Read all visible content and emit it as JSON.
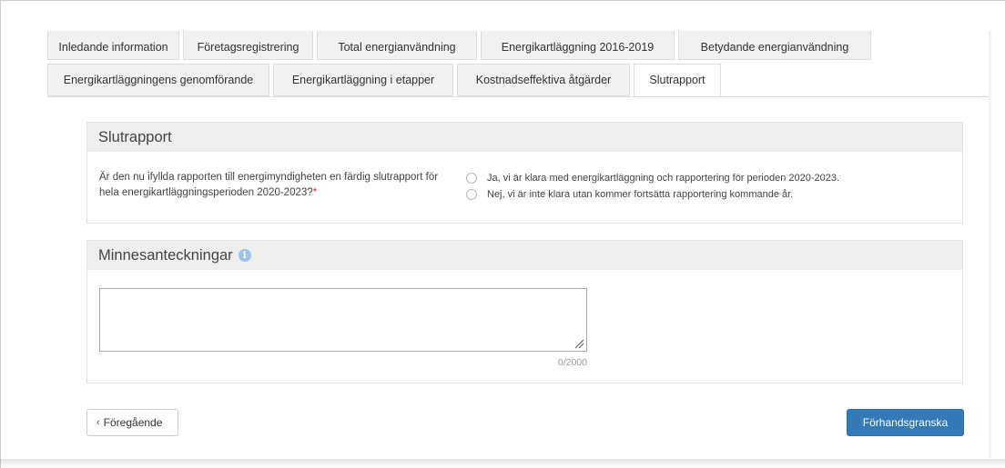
{
  "tabs": {
    "row1": [
      {
        "label": "Inledande information"
      },
      {
        "label": "Företagsregistrering"
      },
      {
        "label": "Total energianvändning"
      },
      {
        "label": "Energikartläggning 2016-2019"
      },
      {
        "label": "Betydande energianvändning"
      }
    ],
    "row2": [
      {
        "label": "Energikartläggningens genomförande"
      },
      {
        "label": "Energikartläggning i etapper"
      },
      {
        "label": "Kostnadseffektiva åtgärder"
      },
      {
        "label": "Slutrapport",
        "active": true
      }
    ]
  },
  "slutrapport": {
    "title": "Slutrapport",
    "question": "Är den nu ifyllda rapporten till energimyndigheten en färdig slutrapport för hela energikartläggningsperioden 2020-2023?",
    "required_mark": "*",
    "options": [
      {
        "label": "Ja, vi är klara med energikartläggning och rapportering för perioden 2020-2023.",
        "selected": false
      },
      {
        "label": "Nej, vi är inte klara utan kommer fortsätta rapportering kommande år.",
        "selected": false
      }
    ]
  },
  "notes": {
    "title": "Minnesanteckningar",
    "info_icon": "info-icon",
    "value": "",
    "counter": "0/2000"
  },
  "buttons": {
    "prev_chevron": "‹",
    "prev_label": "Föregående",
    "next_label": "Förhandsgranska"
  },
  "colors": {
    "primary": "#337ab7",
    "required": "#c9302c",
    "info": "#9ec3ea"
  }
}
